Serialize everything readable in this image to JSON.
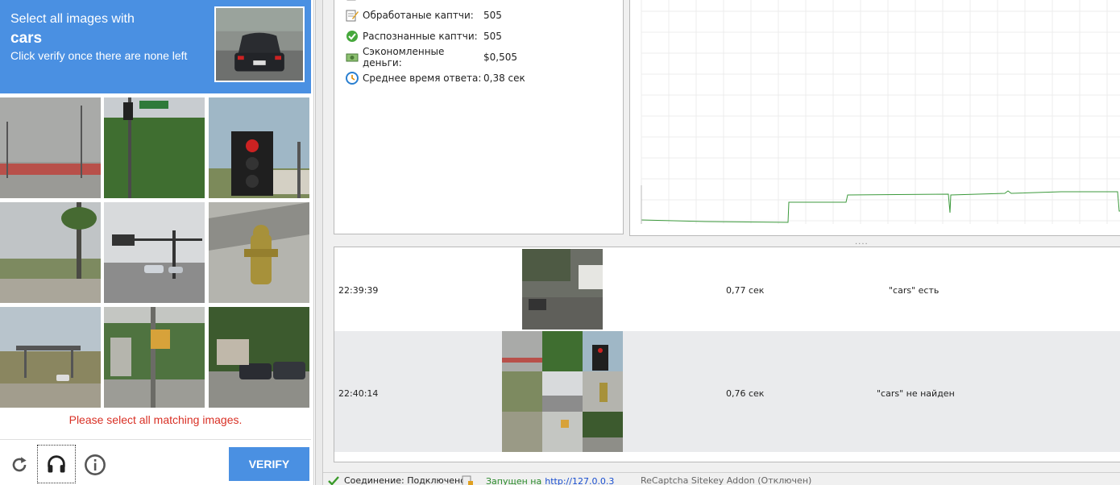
{
  "captcha": {
    "prompt_line1": "Select all images with",
    "prompt_target": "cars",
    "prompt_line3": "Click verify once there are none left",
    "error": "Please select all matching images.",
    "verify_label": "VERIFY",
    "buttons": [
      "reload-icon",
      "headphones-icon",
      "info-icon"
    ]
  },
  "stats": [
    {
      "icon": "pencil-notepad-icon",
      "label": "Обработаные каптчи:",
      "value": "505"
    },
    {
      "icon": "check-circle-icon",
      "label": "Распознанные каптчи:",
      "value": "505"
    },
    {
      "icon": "money-icon",
      "label": "Сэкономленные деньги:",
      "value": "$0,505"
    },
    {
      "icon": "clock-icon",
      "label": "Среднее время ответа:",
      "value": "0,38 сек"
    }
  ],
  "log": [
    {
      "time": "22:39:39",
      "duration": "0,77 сек",
      "result": "\"cars\" есть"
    },
    {
      "time": "22:40:14",
      "duration": "0,76 сек",
      "result": "\"cars\" не найден"
    }
  ],
  "status": {
    "connection_label": "Соединение: Подключено",
    "running_label": "Запущен на",
    "running_url": "http://127.0.0.3",
    "addon_label": "ReCaptcha Sitekey Addon (Отключен)"
  },
  "colors": {
    "captcha_blue": "#4a90e2",
    "error_red": "#d93025",
    "graph_line": "#3c9a3c"
  }
}
